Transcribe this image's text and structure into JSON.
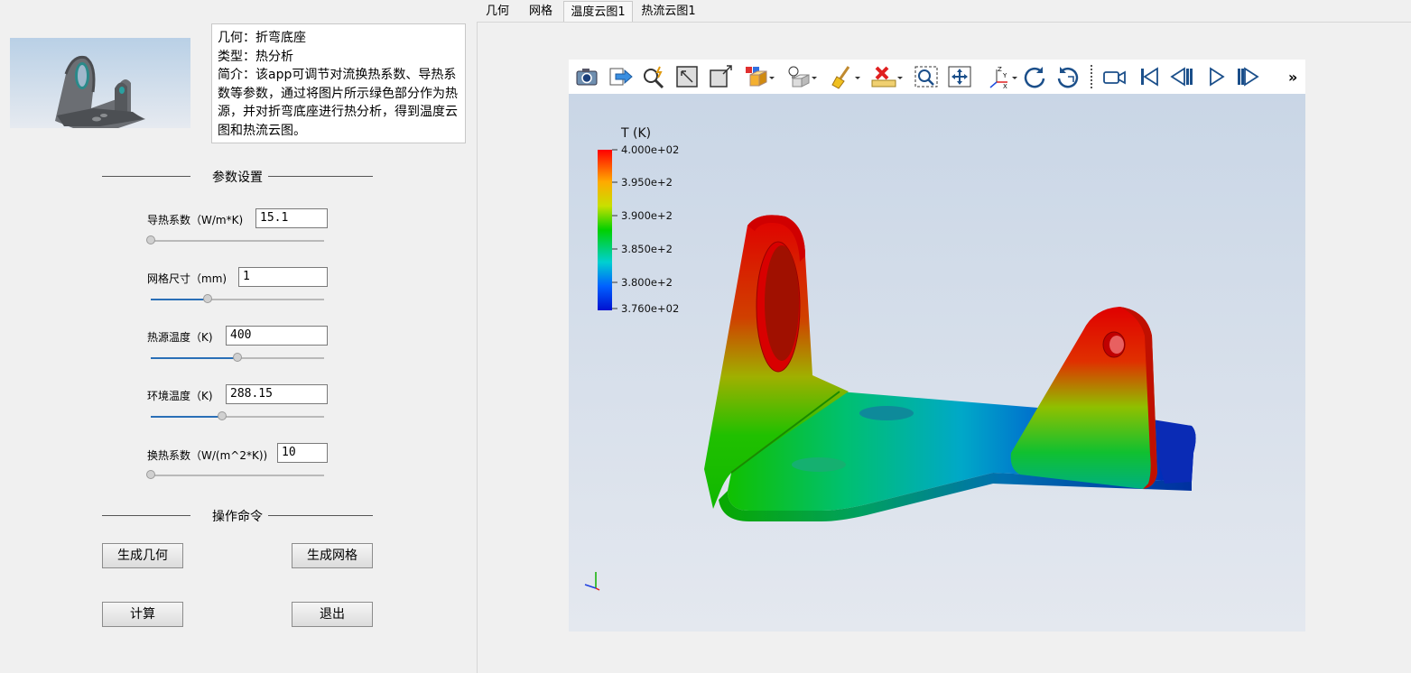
{
  "description": {
    "line1": "几何：折弯底座",
    "line2": "类型：热分析",
    "line3": "简介：该app可调节对流换热系数、导热系数等参数，通过将图片所示绿色部分作为热源，并对折弯底座进行热分析，得到温度云图和热流云图。"
  },
  "sections": {
    "params": "参数设置",
    "commands": "操作命令"
  },
  "params": [
    {
      "label": "导热系数（W/m*K)",
      "value": "15.1",
      "slider": 0.0
    },
    {
      "label": "网格尺寸（mm)",
      "value": "1",
      "slider": 0.33
    },
    {
      "label": "热源温度（K)",
      "value": "400",
      "slider": 0.5
    },
    {
      "label": "环境温度（K)",
      "value": "288.15",
      "slider": 0.41
    },
    {
      "label": "换热系数（W/(m^2*K))",
      "value": "10",
      "slider": 0.0
    }
  ],
  "buttons": {
    "gen_geometry": "生成几何",
    "gen_mesh": "生成网格",
    "compute": "计算",
    "exit": "退出"
  },
  "tabs": [
    {
      "label": "几何",
      "active": false
    },
    {
      "label": "网格",
      "active": false
    },
    {
      "label": "温度云图1",
      "active": true
    },
    {
      "label": "热流云图1",
      "active": false
    }
  ],
  "toolbar": {
    "more": "»",
    "icons": [
      "camera-icon",
      "export-icon",
      "zoom-magic-icon",
      "fit-view-icon",
      "view-box-icon",
      "color-cube-icon",
      "light-icon",
      "clean-icon",
      "delete-measure-icon",
      "zoom-window-icon",
      "pan-icon",
      "axes-icon",
      "rotate-cw-icon",
      "rotate-ccw-icon",
      "video-icon",
      "first-frame-icon",
      "prev-frame-icon",
      "play-icon",
      "next-frame-icon"
    ]
  },
  "colorbar": {
    "title": "T (K)",
    "ticks": [
      "4.000e+02",
      "3.950e+2",
      "3.900e+2",
      "3.850e+2",
      "3.800e+2",
      "3.760e+02"
    ]
  },
  "colors": {
    "accent": "#2a6fb7",
    "hot": "#e00000",
    "cold": "#0020d0"
  }
}
